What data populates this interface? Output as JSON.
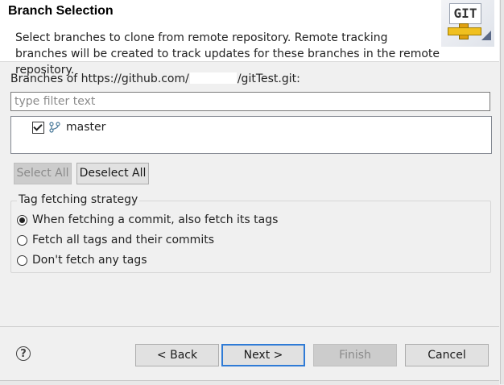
{
  "header": {
    "title": "Branch Selection",
    "description": "Select branches to clone from remote repository. Remote tracking branches will be created to track updates for these branches in the remote repository.",
    "logo_text": "GIT"
  },
  "branches": {
    "label_prefix": "Branches of https://github.com/",
    "label_suffix": "/gitTest.git:",
    "filter_placeholder": "type filter text",
    "items": [
      {
        "name": "master",
        "checked": true,
        "icon": "branch-icon"
      }
    ]
  },
  "buttons": {
    "select_all": "Select All",
    "deselect_all": "Deselect All"
  },
  "tag_strategy": {
    "legend": "Tag fetching strategy",
    "options": [
      {
        "label": "When fetching a commit, also fetch its tags",
        "selected": true
      },
      {
        "label": "Fetch all tags and their commits",
        "selected": false
      },
      {
        "label": "Don't fetch any tags",
        "selected": false
      }
    ]
  },
  "footer": {
    "help_glyph": "?",
    "back": "< Back",
    "next": "Next >",
    "finish": "Finish",
    "cancel": "Cancel"
  },
  "colors": {
    "default_button_border": "#2f7bd6",
    "disabled_text": "#8a8a8a"
  }
}
